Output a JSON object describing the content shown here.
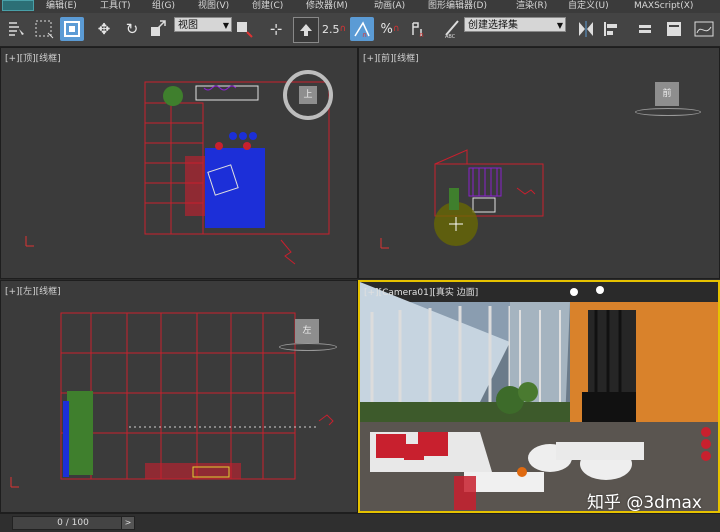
{
  "menu": {
    "items": [
      "编辑(E)",
      "工具(T)",
      "组(G)",
      "视图(V)",
      "创建(C)",
      "修改器(M)",
      "动画(A)",
      "图形编辑器(D)",
      "渲染(R)",
      "自定义(U)",
      "MAXScript(X)"
    ]
  },
  "toolbar": {
    "view_dropdown": "视图",
    "snap_angle": "2.5",
    "selection_set_dropdown": "创建选择集"
  },
  "viewports": {
    "top": {
      "label": "[+][顶][线框]",
      "cube_label": "上"
    },
    "front": {
      "label": "[+][前][线框]",
      "cube_label": "前"
    },
    "left": {
      "label": "[+][左][线框]",
      "cube_label": "左"
    },
    "camera": {
      "label": "[+][Camera01][真实 边面]"
    }
  },
  "timeline": {
    "frame_text": "0 / 100",
    "next_arrow": ">"
  },
  "watermark": "知乎 @3dmax",
  "colors": {
    "wire": "#c8202e",
    "accent": "#5b9bd5",
    "blue_rug": "#1c2fd8",
    "orange_wall": "#d9822b"
  }
}
